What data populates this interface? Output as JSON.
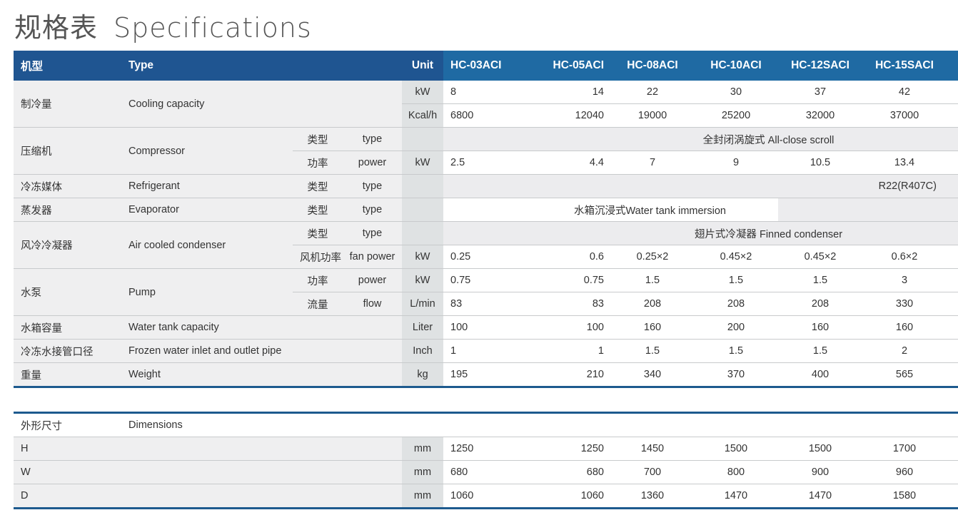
{
  "title": {
    "cn": "规格表",
    "en": "Specifications"
  },
  "header": {
    "cn": "机型",
    "en": "Type",
    "unit": "Unit",
    "models": [
      "HC-03ACI",
      "HC-05ACI",
      "HC-08ACI",
      "HC-10ACI",
      "HC-12SACI",
      "HC-15SACI"
    ]
  },
  "rows": [
    {
      "cn": "制冷量",
      "en": "Cooling capacity",
      "sub": [
        {
          "unit": "kW",
          "values": [
            "8",
            "14",
            "22",
            "30",
            "37",
            "42"
          ]
        },
        {
          "unit": "Kcal/h",
          "values": [
            "6800",
            "12040",
            "19000",
            "25200",
            "32000",
            "37000"
          ]
        }
      ]
    },
    {
      "cn": "压缩机",
      "en": "Compressor",
      "sub": [
        {
          "sub_cn": "类型",
          "sub_en": "type",
          "unit": "",
          "merged": "全封闭涡旋式 All-close scroll"
        },
        {
          "sub_cn": "功率",
          "sub_en": "power",
          "unit": "kW",
          "values": [
            "2.5",
            "4.4",
            "7",
            "9",
            "10.5",
            "13.4"
          ]
        }
      ]
    },
    {
      "cn": "冷冻媒体",
      "en": "Refrigerant",
      "sub": [
        {
          "sub_cn": "类型",
          "sub_en": "type",
          "unit": "",
          "merged_right": "R22(R407C)"
        }
      ]
    },
    {
      "cn": "蒸发器",
      "en": "Evaporator",
      "sub": [
        {
          "sub_cn": "类型",
          "sub_en": "type",
          "unit": "",
          "merged_left": "水箱沉浸式Water tank immersion"
        }
      ]
    },
    {
      "cn": "风冷冷凝器",
      "en": "Air cooled condenser",
      "sub": [
        {
          "sub_cn": "类型",
          "sub_en": "type",
          "unit": "",
          "merged": "翅片式冷凝器 Finned condenser"
        },
        {
          "sub_cn": "风机功率",
          "sub_en": "fan power",
          "unit": "kW",
          "values": [
            "0.25",
            "0.6",
            "0.25×2",
            "0.45×2",
            "0.45×2",
            "0.6×2"
          ]
        }
      ]
    },
    {
      "cn": "水泵",
      "en": "Pump",
      "sub": [
        {
          "sub_cn": "功率",
          "sub_en": "power",
          "unit": "kW",
          "values": [
            "0.75",
            "0.75",
            "1.5",
            "1.5",
            "1.5",
            "3"
          ]
        },
        {
          "sub_cn": "流量",
          "sub_en": "flow",
          "unit": "L/min",
          "values": [
            "83",
            "83",
            "208",
            "208",
            "208",
            "330"
          ]
        }
      ]
    },
    {
      "cn": "水箱容量",
      "en": "Water tank capacity",
      "sub": [
        {
          "unit": "Liter",
          "values": [
            "100",
            "100",
            "160",
            "200",
            "160",
            "160"
          ]
        }
      ]
    },
    {
      "cn": "冷冻水接管口径",
      "en": "Frozen water inlet and outlet pipe",
      "sub": [
        {
          "unit": "Inch",
          "values": [
            "1",
            "1",
            "1.5",
            "1.5",
            "1.5",
            "2"
          ]
        }
      ]
    },
    {
      "cn": "重量",
      "en": "Weight",
      "sub": [
        {
          "unit": "kg",
          "values": [
            "195",
            "210",
            "340",
            "370",
            "400",
            "565"
          ]
        }
      ]
    }
  ],
  "dimensions": {
    "cn": "外形尺寸",
    "en": "Dimensions",
    "rows": [
      {
        "label": "H",
        "unit": "mm",
        "values": [
          "1250",
          "1250",
          "1450",
          "1500",
          "1500",
          "1700"
        ]
      },
      {
        "label": "W",
        "unit": "mm",
        "values": [
          "680",
          "680",
          "700",
          "800",
          "900",
          "960"
        ]
      },
      {
        "label": "D",
        "unit": "mm",
        "values": [
          "1060",
          "1060",
          "1360",
          "1470",
          "1470",
          "1580"
        ]
      }
    ]
  }
}
